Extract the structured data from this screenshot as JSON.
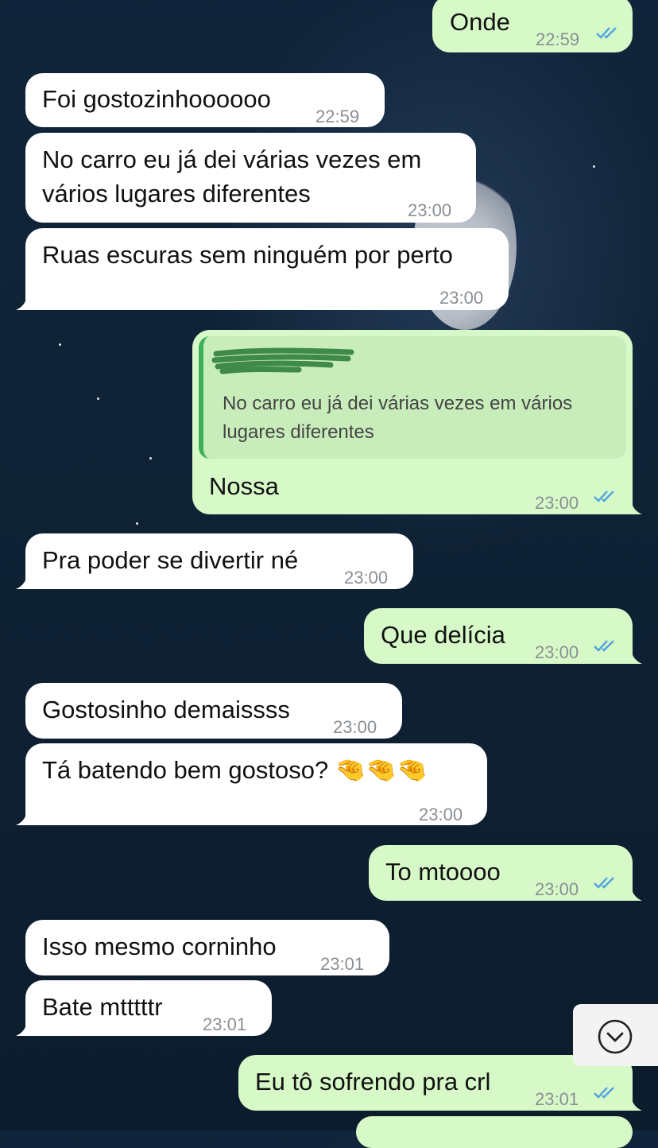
{
  "messages": [
    {
      "side": "out",
      "text": "Onde",
      "time": "22:59",
      "read": true
    },
    {
      "side": "in",
      "text": "Foi gostozinhoooooo",
      "time": "22:59"
    },
    {
      "side": "in",
      "lines": [
        "No carro eu já dei várias vezes em",
        "vários lugares diferentes"
      ],
      "time": "23:00"
    },
    {
      "side": "in",
      "text": "Ruas escuras sem ninguém por perto",
      "time": "23:00"
    },
    {
      "side": "out",
      "quote_lines": [
        "No carro eu já dei várias vezes em vários",
        "lugares diferentes"
      ],
      "text": "Nossa",
      "time": "23:00",
      "read": true
    },
    {
      "side": "in",
      "text": "Pra poder se divertir né",
      "time": "23:00"
    },
    {
      "side": "out",
      "text": "Que delícia",
      "time": "23:00",
      "read": true
    },
    {
      "side": "in",
      "text": "Gostosinho demaissss",
      "time": "23:00"
    },
    {
      "side": "in",
      "text": "Tá batendo bem gostoso? 🤏🤏🤏",
      "time": "23:00"
    },
    {
      "side": "out",
      "text": "To mtoooo",
      "time": "23:00",
      "read": true
    },
    {
      "side": "in",
      "text": "Isso mesmo corninho",
      "time": "23:01"
    },
    {
      "side": "in",
      "text": "Bate mtttttr",
      "time": "23:01"
    },
    {
      "side": "out",
      "text": "Eu tô sofrendo pra crl",
      "time": "23:01",
      "read": true
    }
  ],
  "colors": {
    "incoming": "#ffffff",
    "outgoing": "#d7f9c8",
    "read_ticks": "#4fa3e0"
  },
  "scroll_button_icon": "chevron-down-circle-icon"
}
